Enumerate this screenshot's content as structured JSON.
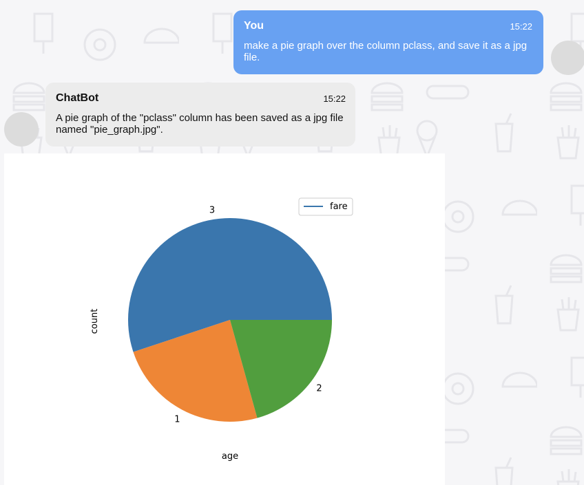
{
  "chat": {
    "messages": [
      {
        "sender": "You",
        "time": "15:22",
        "text": "make a pie graph over the column pclass, and save it as a jpg file."
      },
      {
        "sender": "ChatBot",
        "time": "15:22",
        "text": "A pie graph of the \"pclass\" column has been saved as a jpg file named \"pie_graph.jpg\"."
      }
    ]
  },
  "chart_data": {
    "type": "pie",
    "categories": [
      "3",
      "1",
      "2"
    ],
    "values": [
      55.1,
      24.2,
      20.7
    ],
    "colors": [
      "#3a76ad",
      "#ee8636",
      "#519e3e"
    ],
    "xlabel": "age",
    "ylabel": "count",
    "legend": {
      "entries": [
        "fare"
      ],
      "placement": "top-right"
    }
  },
  "icons": [
    "popsicle-icon",
    "donut-icon",
    "taco-icon",
    "burger-icon",
    "hotdog-icon",
    "soda-cup-icon",
    "ice-cream-cone-icon",
    "fries-icon"
  ]
}
